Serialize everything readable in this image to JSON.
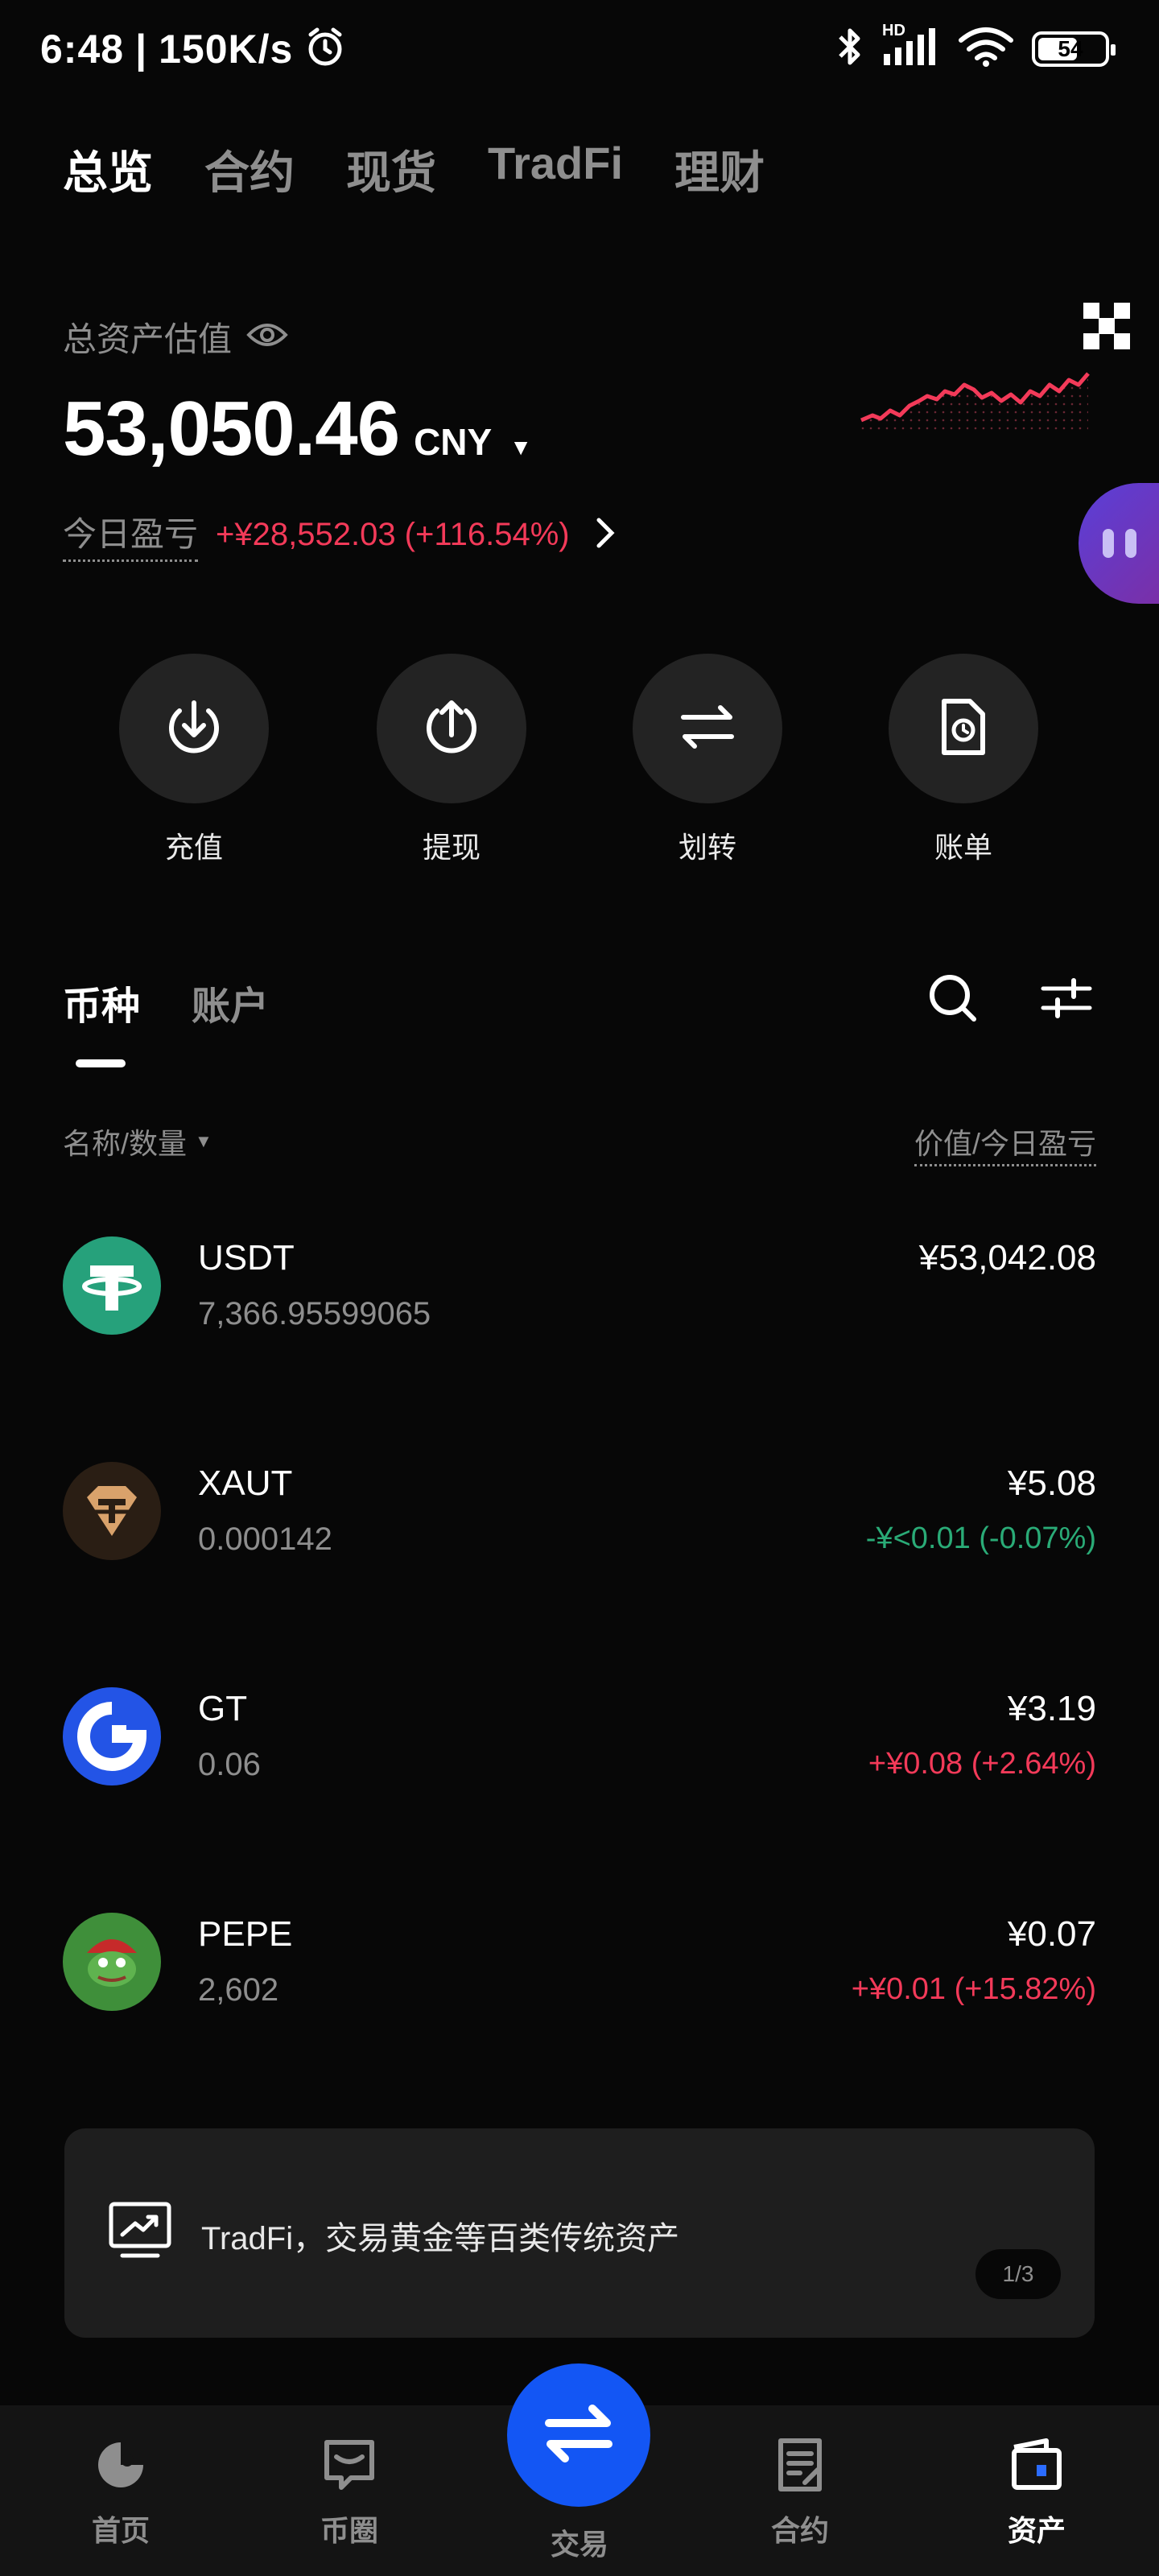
{
  "status_bar": {
    "time": "6:48",
    "speed": "150K/s",
    "battery": "54",
    "network": "HD"
  },
  "top_tabs": [
    "总览",
    "合约",
    "现货",
    "TradFi",
    "理财"
  ],
  "asset": {
    "label": "总资产估值",
    "value": "53,050.46",
    "unit": "CNY",
    "pnl_label": "今日盈亏",
    "pnl_value": "+¥28,552.03 (+116.54%)"
  },
  "actions": [
    {
      "label": "充值",
      "icon": "deposit-icon"
    },
    {
      "label": "提现",
      "icon": "withdraw-icon"
    },
    {
      "label": "划转",
      "icon": "transfer-icon"
    },
    {
      "label": "账单",
      "icon": "bill-icon"
    }
  ],
  "section_tabs": [
    "币种",
    "账户"
  ],
  "list_header": {
    "left": "名称/数量",
    "right": "价值/今日盈亏"
  },
  "coins": [
    {
      "symbol": "USDT",
      "quantity": "7,366.95599065",
      "value": "¥53,042.08",
      "pnl": "",
      "trend": "none"
    },
    {
      "symbol": "XAUT",
      "quantity": "0.000142",
      "value": "¥5.08",
      "pnl": "-¥<0.01 (-0.07%)",
      "trend": "down"
    },
    {
      "symbol": "GT",
      "quantity": "0.06",
      "value": "¥3.19",
      "pnl": "+¥0.08 (+2.64%)",
      "trend": "up"
    },
    {
      "symbol": "PEPE",
      "quantity": "2,602",
      "value": "¥0.07",
      "pnl": "+¥0.01 (+15.82%)",
      "trend": "up"
    }
  ],
  "banner": {
    "text": "TradFi，交易黄金等百类传统资产",
    "page": "1/3"
  },
  "bottom_nav": [
    {
      "label": "首页",
      "icon": "home-icon"
    },
    {
      "label": "币圈",
      "icon": "community-icon"
    },
    {
      "label": "交易",
      "icon": "trade-icon"
    },
    {
      "label": "合约",
      "icon": "futures-icon"
    },
    {
      "label": "资产",
      "icon": "wallet-icon"
    }
  ],
  "colors": {
    "background": "#070707",
    "up": "#f33a59",
    "down": "#2aab77",
    "accent": "#1356f4"
  }
}
